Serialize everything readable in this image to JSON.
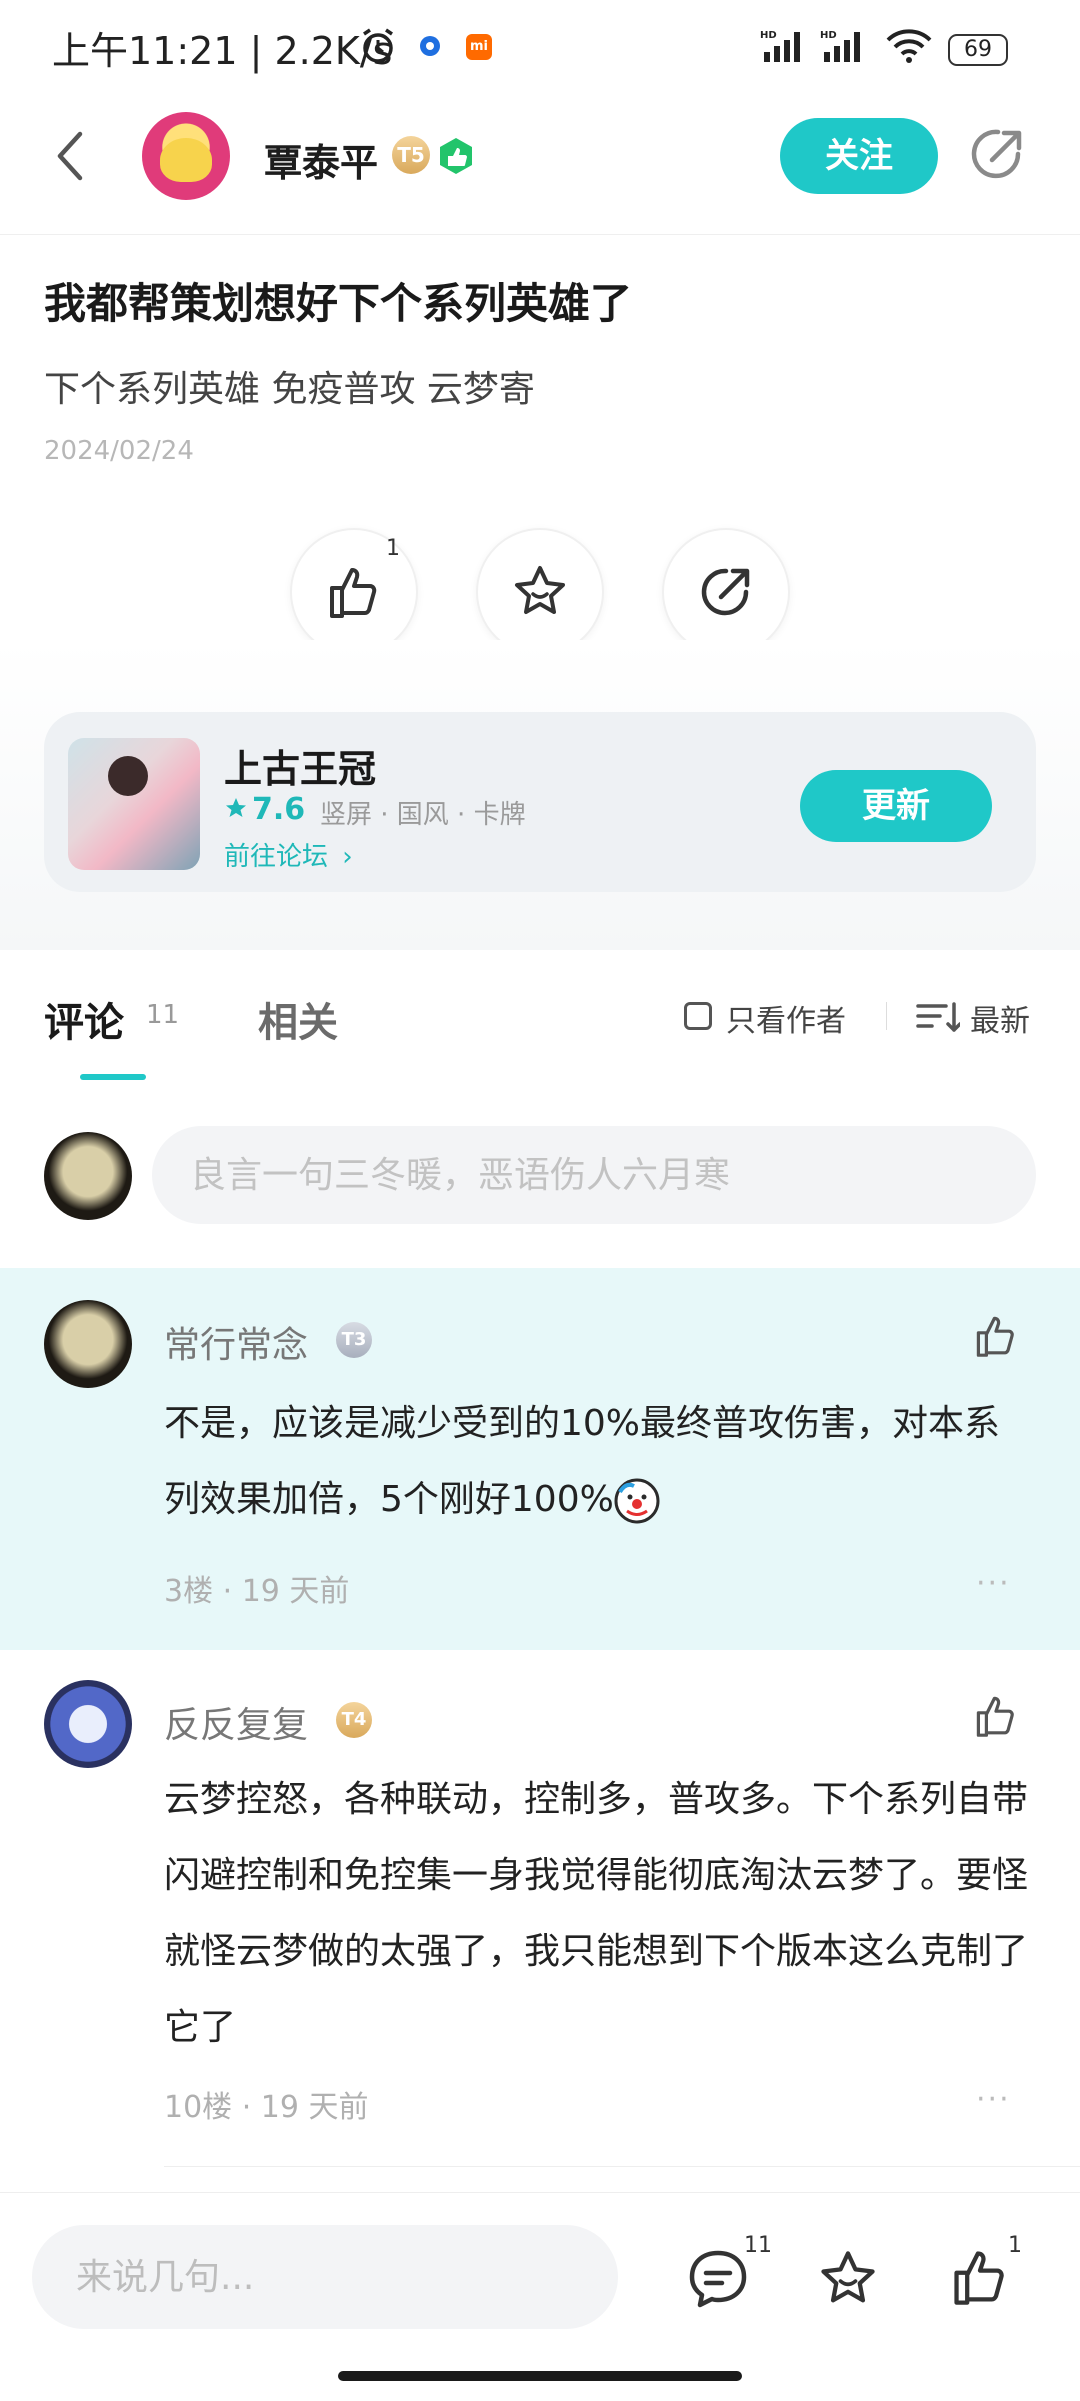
{
  "status_bar": {
    "time": "上午11:21 | 2.2K/s",
    "battery": "69"
  },
  "header": {
    "username": "覃泰平",
    "level_badge": "T5",
    "follow_label": "关注"
  },
  "post": {
    "title": "我都帮策划想好下个系列英雄了",
    "body": "下个系列英雄 免疫普攻 云梦寄",
    "date": "2024/02/24",
    "like_count": "1"
  },
  "game_card": {
    "name": "上古王冠",
    "score": "7.6",
    "tags": "竖屏 · 国风 · 卡牌",
    "forum_link": "前往论坛",
    "update_label": "更新"
  },
  "tabs": {
    "comments_label": "评论",
    "comments_count": "11",
    "related_label": "相关",
    "author_only_label": "只看作者",
    "sort_label": "最新"
  },
  "comment_input": {
    "placeholder": "良言一句三冬暖，恶语伤人六月寒"
  },
  "comments": [
    {
      "name": "常行常念",
      "level": "T3",
      "text": "不是，应该是减少受到的10%最终普攻伤害，对本系列效果加倍，5个刚好100%",
      "floor": "3楼",
      "time": "19 天前",
      "more": "···"
    },
    {
      "name": "反反复复",
      "level": "T4",
      "text": "云梦控怒，各种联动，控制多，普攻多。下个系列自带闪避控制和免控集一身我觉得能彻底淘汰云梦了。要怪就怪云梦做的太强了，我只能想到下个版本这么克制了它了",
      "floor": "10楼",
      "time": "19 天前",
      "more": "···"
    }
  ],
  "bottom_bar": {
    "placeholder": "来说几句...",
    "comment_count": "11",
    "like_count": "1"
  },
  "colors": {
    "accent": "#1fc8c8",
    "highlight_bg": "#e7f8f9"
  }
}
